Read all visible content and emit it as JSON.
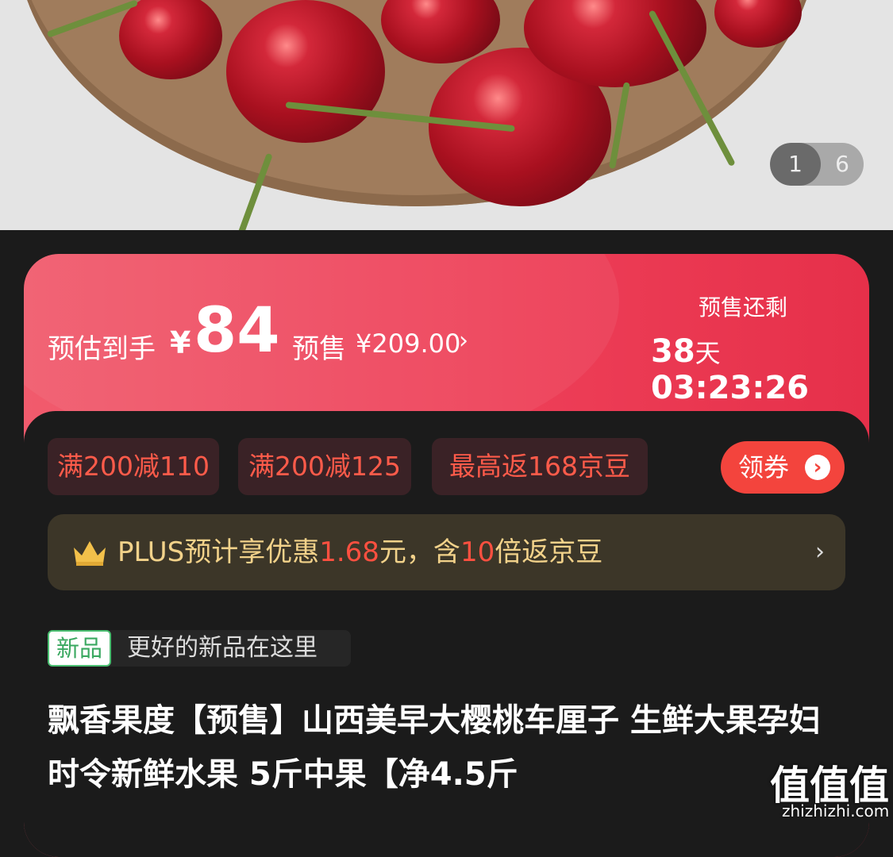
{
  "gallery": {
    "current": "1",
    "total": "6"
  },
  "price": {
    "estimate_label": "预估到手",
    "currency": "¥",
    "estimate_value": "84",
    "presale_label": "预售",
    "presale_value": "¥209.00",
    "presale_chevron": "›",
    "remaining_label": "预售还剩",
    "days": "38",
    "days_unit": "天",
    "time": "03:23:26"
  },
  "coupons": [
    "满200减110",
    "满200减125",
    "最高返168京豆"
  ],
  "get_coupon": {
    "label": "领券",
    "icon": "›"
  },
  "plus": {
    "badge": "PLUS",
    "text_a": "预计享优惠",
    "amount": "1.68",
    "text_b": "元，含",
    "multiplier": "10",
    "text_c": "倍返京豆",
    "chevron": "›"
  },
  "new_tag": {
    "badge": "新品",
    "text": "更好的新品在这里"
  },
  "product_title": "飘香果度【预售】山西美早大樱桃车厘子 生鲜大果孕妇时令新鲜水果 5斤中果【净4.5斤",
  "watermark": {
    "main": "值值值",
    "url": "zhizhizhi.com"
  },
  "colors": {
    "accent_red": "#f3443d",
    "card_red": "#ed3e57",
    "plus_gold": "#f2d28a",
    "new_green": "#4bbf72"
  }
}
